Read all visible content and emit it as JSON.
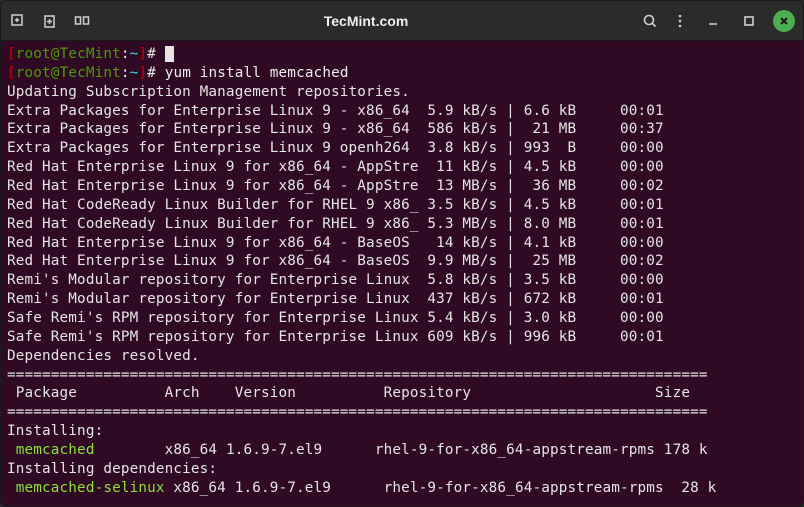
{
  "titlebar": {
    "title": "TecMint.com"
  },
  "prompt": {
    "bracket_open": "[",
    "user": "root",
    "at": "@",
    "host": "TecMint",
    "colon": ":",
    "path": "~",
    "bracket_close": "]",
    "hash": "#"
  },
  "command": "yum install memcached",
  "lines": [
    "Updating Subscription Management repositories.",
    "Extra Packages for Enterprise Linux 9 - x86_64  5.9 kB/s | 6.6 kB     00:01",
    "Extra Packages for Enterprise Linux 9 - x86_64  586 kB/s |  21 MB     00:37",
    "Extra Packages for Enterprise Linux 9 openh264  3.8 kB/s | 993  B     00:00",
    "Red Hat Enterprise Linux 9 for x86_64 - AppStre  11 kB/s | 4.5 kB     00:00",
    "Red Hat Enterprise Linux 9 for x86_64 - AppStre  13 MB/s |  36 MB     00:02",
    "Red Hat CodeReady Linux Builder for RHEL 9 x86_ 3.5 kB/s | 4.5 kB     00:01",
    "Red Hat CodeReady Linux Builder for RHEL 9 x86_ 5.3 MB/s | 8.0 MB     00:01",
    "Red Hat Enterprise Linux 9 for x86_64 - BaseOS   14 kB/s | 4.1 kB     00:00",
    "Red Hat Enterprise Linux 9 for x86_64 - BaseOS  9.9 MB/s |  25 MB     00:02",
    "Remi's Modular repository for Enterprise Linux  5.8 kB/s | 3.5 kB     00:00",
    "Remi's Modular repository for Enterprise Linux  437 kB/s | 672 kB     00:01",
    "Safe Remi's RPM repository for Enterprise Linux 5.4 kB/s | 3.0 kB     00:00",
    "Safe Remi's RPM repository for Enterprise Linux 609 kB/s | 996 kB     00:01",
    "Dependencies resolved."
  ],
  "divider": "================================================================================",
  "table_header": " Package          Arch    Version          Repository                     Size",
  "installing_label": "Installing:",
  "install_row1_name": " memcached",
  "install_row1_rest": "        x86_64 1.6.9-7.el9      rhel-9-for-x86_64-appstream-rpms 178 k",
  "installing_deps_label": "Installing dependencies:",
  "install_row2_name": " memcached-selinux",
  "install_row2_rest": " x86_64 1.6.9-7.el9      rhel-9-for-x86_64-appstream-rpms  28 k"
}
